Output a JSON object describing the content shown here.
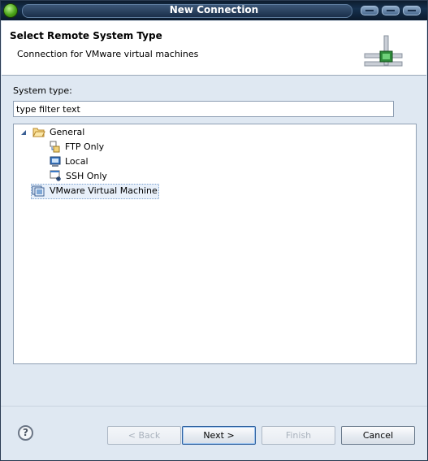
{
  "window": {
    "title": "New Connection"
  },
  "header": {
    "title": "Select Remote System Type",
    "description": "Connection for VMware virtual machines"
  },
  "system_type": {
    "label": "System type:",
    "filter_value": "type filter text"
  },
  "tree": {
    "general": {
      "label": "General",
      "expanded": true
    },
    "children": [
      {
        "label": "FTP Only",
        "icon": "ftp-icon"
      },
      {
        "label": "Local",
        "icon": "local-computer-icon"
      },
      {
        "label": "SSH Only",
        "icon": "ssh-icon"
      }
    ],
    "vmware": {
      "label": "VMware Virtual Machine",
      "icon": "vmware-icon",
      "selected": true
    }
  },
  "buttons": {
    "back": "< Back",
    "next": "Next >",
    "finish": "Finish",
    "cancel": "Cancel"
  },
  "help_icon": "?"
}
